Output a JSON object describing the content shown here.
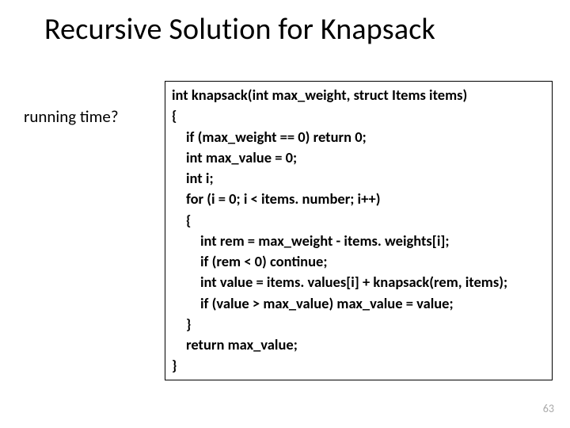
{
  "title": "Recursive Solution for Knapsack",
  "left_note": "running time?",
  "code": {
    "l1a": "int knapsack(int max_weight, struct Items items)",
    "l1b": "{",
    "l2": "if (max_weight == 0) return 0;",
    "l3": "int max_value = 0;",
    "l4": "int i;",
    "l5": "for (i = 0; i < items. number; i++)",
    "l6": "{",
    "l7": "int rem = max_weight - items. weights[i];",
    "l8": "if (rem < 0) continue;",
    "l9": "int value = items. values[i] + knapsack(rem, items);",
    "l10": "if (value > max_value) max_value = value;",
    "l11": "}",
    "l12": "return max_value;",
    "l13": "}"
  },
  "page_number": "63"
}
